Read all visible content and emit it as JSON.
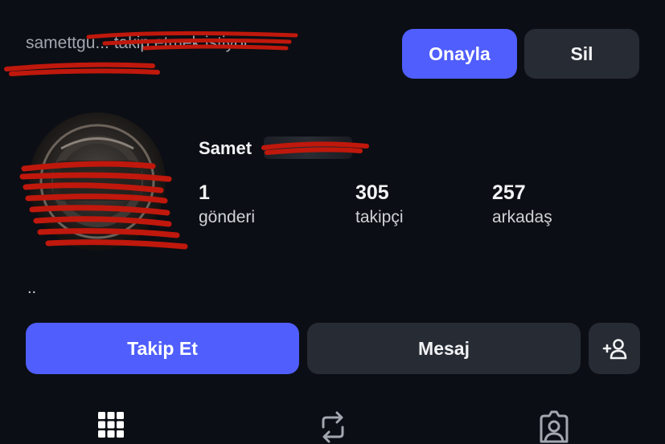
{
  "request": {
    "text": "samettgu... takip etmek istiyor"
  },
  "actions": {
    "confirm_label": "Onayla",
    "delete_label": "Sil"
  },
  "profile": {
    "name": "Samet",
    "bio": ".."
  },
  "stats": [
    {
      "value": "1",
      "label": "gönderi"
    },
    {
      "value": "305",
      "label": "takipçi"
    },
    {
      "value": "257",
      "label": "arkadaş"
    }
  ],
  "buttons": {
    "follow_label": "Takip Et",
    "message_label": "Mesaj"
  },
  "icons": {
    "add_friend": "person-plus-icon",
    "tab_posts": "grid-icon",
    "tab_reposts": "repost-icon",
    "tab_tagged": "tagged-person-icon"
  },
  "colors": {
    "background": "#0b0e14",
    "primary": "#4f5efc",
    "secondary_button": "#272b33",
    "redaction": "#c0180c"
  }
}
